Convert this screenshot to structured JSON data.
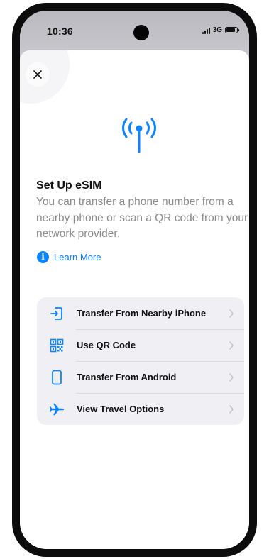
{
  "status_bar": {
    "time": "10:36",
    "network": "3G",
    "signal_icon": "signal-bars-icon",
    "battery_icon": "battery-icon"
  },
  "sheet": {
    "close_icon": "close-icon",
    "hero_icon": "antenna-signal-icon",
    "title": "Set Up eSIM",
    "description": "You can transfer a phone number from a nearby phone or scan a QR code from your network provider.",
    "learn_more": {
      "icon": "info-icon",
      "label": "Learn More"
    },
    "options": [
      {
        "label": "Transfer From Nearby iPhone",
        "icon": "transfer-in-icon"
      },
      {
        "label": "Use QR Code",
        "icon": "qr-code-icon"
      },
      {
        "label": "Transfer From Android",
        "icon": "phone-icon"
      },
      {
        "label": "View Travel Options",
        "icon": "airplane-icon"
      }
    ]
  },
  "colors": {
    "accent": "#0a84ff",
    "option_background": "#f0f0f4",
    "secondary_text": "#8a8a8e",
    "frame": "#0c0c0c"
  }
}
